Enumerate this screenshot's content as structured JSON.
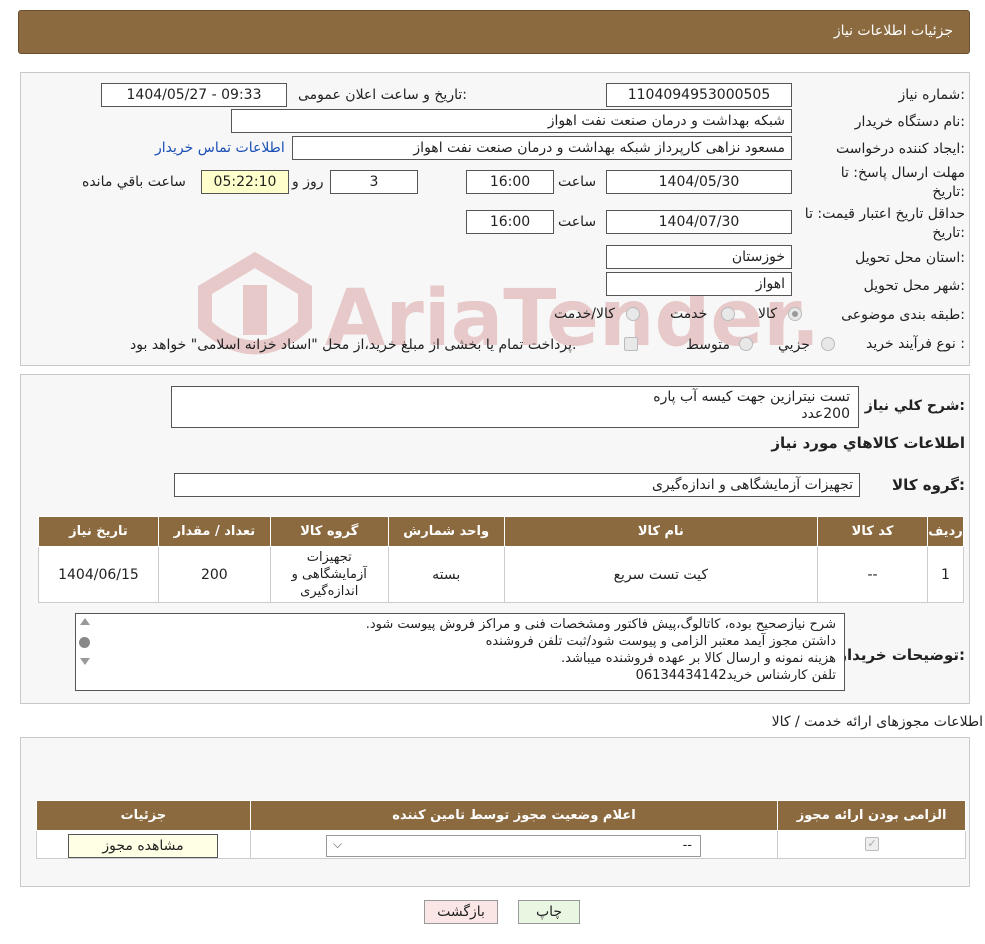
{
  "header": {
    "title": "جزئیات اطلاعات نیاز"
  },
  "form": {
    "need_number_label": "شماره نیاز:",
    "need_number": "1104094953000505",
    "announce_label": "تاریخ و ساعت اعلان عمومی:",
    "announce_value": "1404/05/27 - 09:33",
    "buyer_org_label": "نام دستگاه خریدار:",
    "buyer_org": "شبکه بهداشت و درمان صنعت نفت اهواز",
    "creator_label": "ایجاد کننده درخواست:",
    "creator": "مسعود نزاهی کارپرداز شبکه بهداشت و درمان صنعت نفت اهواز",
    "contact_link": "اطلاعات تماس خریدار",
    "reply_deadline_label_1": "مهلت ارسال پاسخ: تا",
    "reply_deadline_label_2": "تاریخ:",
    "reply_date": "1404/05/30",
    "time_label": "ساعت",
    "reply_time": "16:00",
    "days": "3",
    "days_label": "روز و",
    "remaining_time": "05:22:10",
    "remaining_label": "ساعت باقي مانده",
    "price_validity_label_1": "حداقل تاریخ اعتبار قیمت: تا",
    "price_validity_label_2": "تاریخ:",
    "validity_date": "1404/07/30",
    "validity_time": "16:00",
    "province_label": "استان محل تحویل:",
    "province": "خوزستان",
    "city_label": "شهر محل تحویل:",
    "city": "اهواز",
    "category_label": "طبقه بندی موضوعی:",
    "category_options": [
      "کالا",
      "خدمت",
      "کالا/خدمت"
    ],
    "purchase_type_label": "نوع فرآیند خرید :",
    "purchase_options": [
      "جزيي",
      "متوسط"
    ],
    "purchase_note": "پرداخت تمام یا بخشی از مبلغ خرید،از محل \"اسناد خزانه اسلامی\" خواهد بود."
  },
  "watermark_text": "AriaTender.neT",
  "summary": {
    "general_desc_label": "شرح كلي نياز:",
    "general_desc_line1": "تست نیترازین جهت کیسه آب پاره",
    "general_desc_line2": "200عدد",
    "goods_info_title": "اطلاعات كالاهاي مورد نياز",
    "goods_group_label": "گروه كالا:",
    "goods_group": "تجهیزات آزمایشگاهی و اندازه‌گیری"
  },
  "goods_table": {
    "headers": [
      "رديف",
      "كد كالا",
      "نام كالا",
      "واحد شمارش",
      "گروه كالا",
      "تعداد / مقدار",
      "تاریخ نیاز"
    ],
    "row": [
      "1",
      "--",
      "کیت تست سریع",
      "بسته",
      "تجهیزات آزمایشگاهی و اندازه‌گیری",
      "200",
      "1404/06/15"
    ]
  },
  "buyer_notes": {
    "label": "توضيحات خريدار:",
    "lines": [
      "شرح نیازصحیح بوده، کاتالوگ،پیش فاکتور ومشخصات فنی و مراکز فروش پیوست شود.",
      "داشتن مجوز آیمد معتبر الزامی و پیوست شود/ثبت تلفن فروشنده",
      "هزینه  نمونه و ارسال کالا بر عهده فروشنده میباشد.",
      "تلفن کارشناس خرید06134434142"
    ]
  },
  "permits": {
    "title": "اطلاعات مجوزهای ارائه خدمت / کالا",
    "headers": [
      "الزامی بودن ارائه مجوز",
      "اعلام وضعیت مجوز توسط تامین کننده",
      "جزئیات"
    ],
    "select_value": "--",
    "view_button": "مشاهده مجوز"
  },
  "footer": {
    "print_button": "چاپ",
    "back_button": "بازگشت"
  }
}
